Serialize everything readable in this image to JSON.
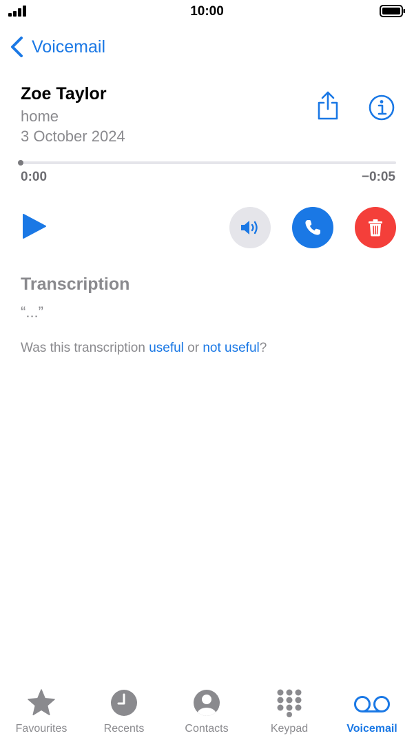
{
  "status_bar": {
    "time": "10:00"
  },
  "nav": {
    "back_label": "Voicemail"
  },
  "contact": {
    "name": "Zoe Taylor",
    "label": "home",
    "date": "3 October 2024"
  },
  "playback": {
    "elapsed": "0:00",
    "remaining": "−0:05",
    "progress_fraction": 0.0
  },
  "transcription": {
    "title": "Transcription",
    "text": "“...”"
  },
  "feedback": {
    "prefix": "Was this transcription ",
    "useful": "useful",
    "middle": " or ",
    "not_useful": "not useful",
    "suffix": "?"
  },
  "tabs": [
    {
      "label": "Favourites",
      "icon": "star-icon",
      "active": false
    },
    {
      "label": "Recents",
      "icon": "clock-icon",
      "active": false
    },
    {
      "label": "Contacts",
      "icon": "person-circle-icon",
      "active": false
    },
    {
      "label": "Keypad",
      "icon": "keypad-icon",
      "active": false
    },
    {
      "label": "Voicemail",
      "icon": "voicemail-icon",
      "active": true
    }
  ],
  "colors": {
    "accent": "#1a78e5",
    "destructive": "#f43f3a",
    "secondary_text": "#8a8a8e",
    "speaker_bg": "#e5e5ea"
  }
}
